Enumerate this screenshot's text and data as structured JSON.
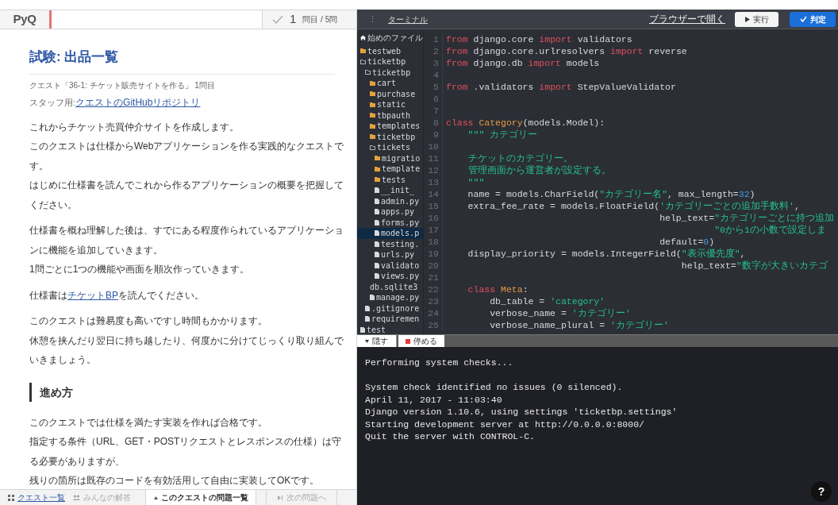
{
  "header": {
    "logo": "PyQ",
    "progress": {
      "level": 0.01,
      "current": "1",
      "total": "問目 / 5問",
      "done": false
    }
  },
  "lesson": {
    "title": "試験: 出品一覧",
    "quest": "クエスト「36-1: チケット販売サイトを作る」 1問目",
    "staff_label": "スタッフ用: ",
    "staff_link": "クエストのGitHubリポジトリ",
    "blocks": [
      {
        "kind": "para",
        "lines": [
          {
            "text": "これからチケット売買仲介サイトを作成します。"
          },
          {
            "text": "このクエストは仕様からWebアプリケーションを作る実践的なクエストです。"
          },
          {
            "text": "はじめに仕様書を読んでこれから作るアプリケーションの概要を把握してください。"
          }
        ]
      },
      {
        "kind": "para",
        "lines": [
          {
            "text": "仕様書を概ね理解した後は、すでにある程度作られているアプリケーションに機能を追加していきます。"
          },
          {
            "text": "1問ごとに1つの機能や画面を順次作っていきます。"
          }
        ]
      },
      {
        "kind": "para",
        "lines": [
          {
            "text": "仕様書は",
            "link": "チケットBP",
            "after": "を読んでください。"
          }
        ]
      },
      {
        "kind": "para",
        "lines": [
          {
            "text": "このクエストは難易度も高いですし時間もかかります。"
          },
          {
            "text": "休憩を挟んだり翌日に持ち越したり、何度かに分けてじっくり取り組んでいきましょう。"
          }
        ]
      },
      {
        "kind": "heading",
        "text": "進め方"
      },
      {
        "kind": "para",
        "lines": [
          {
            "text": "このクエストでは仕様を満たす実装を作れば合格です。"
          },
          {
            "text": "指定する条件（URL、GET・POSTリクエストとレスポンスの仕様）は守る必要がありますが、"
          },
          {
            "text": "残りの箇所は既存のコードを有効活用して自由に実装してOKです。"
          }
        ]
      }
    ]
  },
  "footer": {
    "quest_list": "クエスト一覧",
    "answers": {
      "label": "みんなの解答",
      "disabled": true
    },
    "problem_list": "このクエストの問題一覧",
    "next": {
      "label": "次の問題へ",
      "disabled": true
    }
  },
  "ide": {
    "menu_icon": "⋮",
    "terminal_link": "ターミナル",
    "open_browser": "ブラウザーで開く",
    "run": "実行",
    "judge": "判定",
    "tree": [
      {
        "kind": "home",
        "name": "始めのファイル",
        "selected": false
      },
      {
        "kind": "folder",
        "name": "testweb",
        "selected": false
      },
      {
        "kind": "open",
        "name": "ticketbp",
        "selected": false,
        "children": [
          {
            "kind": "open",
            "name": "ticketbp",
            "selected": false,
            "children": [
              {
                "kind": "folder",
                "name": "cart",
                "selected": false
              },
              {
                "kind": "folder",
                "name": "purchase",
                "selected": false
              },
              {
                "kind": "folder",
                "name": "static",
                "selected": false
              },
              {
                "kind": "folder",
                "name": "tbpauth",
                "selected": false
              },
              {
                "kind": "folder",
                "name": "templates",
                "selected": false
              },
              {
                "kind": "folder",
                "name": "ticketbp",
                "selected": false
              },
              {
                "kind": "open",
                "name": "tickets",
                "selected": false,
                "children": [
                  {
                    "kind": "folder",
                    "name": "migratio",
                    "selected": false
                  },
                  {
                    "kind": "folder",
                    "name": "template",
                    "selected": false
                  },
                  {
                    "kind": "folder",
                    "name": "tests",
                    "selected": false
                  },
                  {
                    "kind": "file",
                    "name": "__init_",
                    "selected": false
                  },
                  {
                    "kind": "file",
                    "name": "admin.py",
                    "selected": false
                  },
                  {
                    "kind": "file",
                    "name": "apps.py",
                    "selected": false
                  },
                  {
                    "kind": "file",
                    "name": "forms.py",
                    "selected": false
                  },
                  {
                    "kind": "file",
                    "name": "models.p",
                    "selected": true
                  },
                  {
                    "kind": "file",
                    "name": "testing.",
                    "selected": false
                  },
                  {
                    "kind": "file",
                    "name": "urls.py",
                    "selected": false
                  },
                  {
                    "kind": "file",
                    "name": "validato",
                    "selected": false
                  },
                  {
                    "kind": "file",
                    "name": "views.py",
                    "selected": false
                  }
                ]
              },
              {
                "kind": "plain",
                "name": "db.sqlite3",
                "selected": false
              },
              {
                "kind": "file",
                "name": "manage.py",
                "selected": false
              }
            ]
          },
          {
            "kind": "file",
            "name": ".gitignore",
            "selected": false
          },
          {
            "kind": "file",
            "name": "requiremen",
            "selected": false
          }
        ]
      },
      {
        "kind": "file",
        "name": "test",
        "selected": false
      }
    ],
    "code": [
      {
        "number": "1",
        "tokens": [
          {
            "kind": "kw",
            "text": "from"
          },
          {
            "kind": "plain",
            "text": " django.core "
          },
          {
            "kind": "kw",
            "text": "import"
          },
          {
            "kind": "plain",
            "text": " validators"
          }
        ]
      },
      {
        "number": "2",
        "tokens": [
          {
            "kind": "kw",
            "text": "from"
          },
          {
            "kind": "plain",
            "text": " django.core.urlresolvers "
          },
          {
            "kind": "kw",
            "text": "import"
          },
          {
            "kind": "plain",
            "text": " reverse"
          }
        ]
      },
      {
        "number": "3",
        "tokens": [
          {
            "kind": "kw",
            "text": "from"
          },
          {
            "kind": "plain",
            "text": " django.db "
          },
          {
            "kind": "kw",
            "text": "import"
          },
          {
            "kind": "plain",
            "text": " models"
          }
        ]
      },
      {
        "number": "4"
      },
      {
        "number": "5",
        "tokens": [
          {
            "kind": "kw",
            "text": "from"
          },
          {
            "kind": "plain",
            "text": " .validators "
          },
          {
            "kind": "kw",
            "text": "import"
          },
          {
            "kind": "plain",
            "text": " StepValueValidator"
          }
        ]
      },
      {
        "number": "6"
      },
      {
        "number": "7"
      },
      {
        "number": "8",
        "tokens": [
          {
            "kind": "kw",
            "text": "class"
          },
          {
            "kind": "cls",
            "text": " Category"
          },
          {
            "kind": "plain",
            "text": "(models.Model):"
          }
        ]
      },
      {
        "number": "9",
        "tokens": [
          {
            "kind": "str",
            "text": "    \"\"\" カテゴリー"
          }
        ]
      },
      {
        "number": "10"
      },
      {
        "number": "11",
        "tokens": [
          {
            "kind": "str",
            "text": "    チケットのカテゴリー。"
          }
        ]
      },
      {
        "number": "12",
        "tokens": [
          {
            "kind": "str",
            "text": "    管理画面から運営者が設定する。"
          }
        ]
      },
      {
        "number": "13",
        "tokens": [
          {
            "kind": "str",
            "text": "    \"\"\""
          }
        ]
      },
      {
        "number": "14",
        "tokens": [
          {
            "kind": "plain",
            "text": "    name = models.CharField("
          },
          {
            "kind": "str",
            "text": "\"カテゴリー名\""
          },
          {
            "kind": "plain",
            "text": ", max_length="
          },
          {
            "kind": "num",
            "text": "32"
          },
          {
            "kind": "plain",
            "text": ")"
          }
        ]
      },
      {
        "number": "15",
        "tokens": [
          {
            "kind": "plain",
            "text": "    extra_fee_rate = models.FloatField("
          },
          {
            "kind": "str",
            "text": "'カテゴリーごとの追加手数料'"
          },
          {
            "kind": "plain",
            "text": ","
          }
        ]
      },
      {
        "number": "16",
        "tokens": [
          {
            "kind": "plain",
            "text": "                                       help_text="
          },
          {
            "kind": "str",
            "text": "\"カテゴリーごとに持つ追加"
          }
        ]
      },
      {
        "number": "17",
        "tokens": [
          {
            "kind": "str",
            "text": "                                                 \"0から1の小数で設定しま"
          }
        ]
      },
      {
        "number": "18",
        "tokens": [
          {
            "kind": "plain",
            "text": "                                       default="
          },
          {
            "kind": "num",
            "text": "0"
          },
          {
            "kind": "plain",
            "text": ")"
          }
        ]
      },
      {
        "number": "19",
        "tokens": [
          {
            "kind": "plain",
            "text": "    display_priority = models.IntegerField("
          },
          {
            "kind": "str",
            "text": "\"表示優先度\""
          },
          {
            "kind": "plain",
            "text": ","
          }
        ]
      },
      {
        "number": "20",
        "tokens": [
          {
            "kind": "plain",
            "text": "                                           help_text="
          },
          {
            "kind": "str",
            "text": "\"数字が大きいカテゴ"
          }
        ]
      },
      {
        "number": "21"
      },
      {
        "number": "22",
        "tokens": [
          {
            "kind": "kw",
            "text": "    class"
          },
          {
            "kind": "cls",
            "text": " Meta"
          },
          {
            "kind": "plain",
            "text": ":"
          }
        ]
      },
      {
        "number": "23",
        "tokens": [
          {
            "kind": "plain",
            "text": "        db_table = "
          },
          {
            "kind": "str",
            "text": "'category'"
          }
        ]
      },
      {
        "number": "24",
        "tokens": [
          {
            "kind": "plain",
            "text": "        verbose_name = "
          },
          {
            "kind": "str",
            "text": "'カテゴリー'"
          }
        ]
      },
      {
        "number": "25",
        "tokens": [
          {
            "kind": "plain",
            "text": "        verbose_name_plural = "
          },
          {
            "kind": "str",
            "text": "'カテゴリー'"
          }
        ]
      }
    ],
    "hide": "隠す",
    "stop": "停める",
    "terminal": [
      [
        "Performing system checks..."
      ],
      [
        "System check identified no issues (0 silenced).",
        "April 11, 2017 - 11:03:40",
        "Django version 1.10.6, using settings 'ticketbp.settings'",
        "Starting development server at http://0.0.0.0:8000/",
        "Quit the server with CONTROL-C."
      ]
    ],
    "help": "?"
  }
}
